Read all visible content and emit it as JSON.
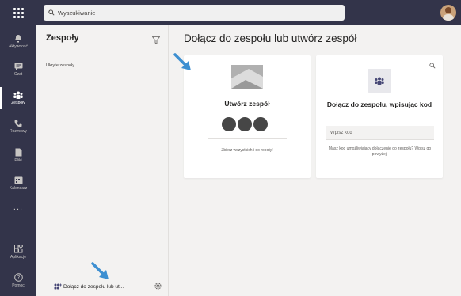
{
  "topbar": {
    "search_placeholder": "Wyszukiwanie",
    "apps_icon": "apps-grid-icon",
    "avatar_icon": "user-avatar"
  },
  "rail": {
    "items": [
      {
        "label": "Aktywność",
        "icon": "bell-icon"
      },
      {
        "label": "Czat",
        "icon": "chat-icon"
      },
      {
        "label": "Zespoły",
        "icon": "teams-icon",
        "active": true
      },
      {
        "label": "Rozmowy",
        "icon": "phone-icon"
      },
      {
        "label": "Pliki",
        "icon": "file-icon"
      },
      {
        "label": "Kalendarz",
        "icon": "calendar-icon"
      },
      {
        "label": "...",
        "icon": "more-icon"
      },
      {
        "label": "Aplikacje",
        "icon": "apps-icon"
      },
      {
        "label": "Pomoc",
        "icon": "help-icon"
      }
    ]
  },
  "panel": {
    "title": "Zespoły",
    "hidden_teams": "Ukryte zespoły",
    "join_label": "Dołącz do zespołu lub ut...",
    "join_icon": "add-team-icon",
    "settings_icon": "gear-icon",
    "filter_icon": "filter-icon"
  },
  "main": {
    "title": "Dołącz do zespołu lub utwórz zespół",
    "create_card": {
      "title": "Utwórz zespół",
      "description": "Zbierz wszystkich i do roboty!"
    },
    "join_card": {
      "title": "Dołącz do zespołu, wpisując kod",
      "input_placeholder": "Wpisz kod",
      "description": "Masz kod umożliwiający dołączenie do zespołu? Wpisz go powyżej."
    }
  },
  "colors": {
    "rail_bg": "#33344a",
    "panel_bg": "#f3f2f1",
    "arrow": "#3d8fd1"
  }
}
